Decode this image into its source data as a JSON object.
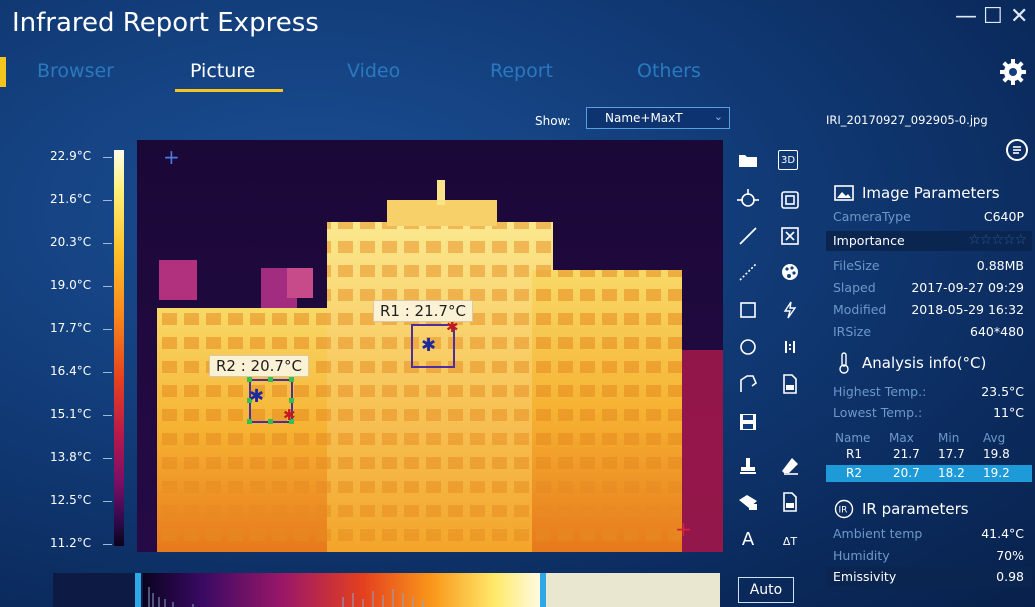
{
  "app": {
    "title": "Infrared Report Express"
  },
  "window": {
    "minimize": "—",
    "maximize": "☐",
    "close": "✕"
  },
  "tabs": [
    {
      "label": "Browser",
      "active": false
    },
    {
      "label": "Picture",
      "active": true
    },
    {
      "label": "Video",
      "active": false
    },
    {
      "label": "Report",
      "active": false
    },
    {
      "label": "Others",
      "active": false
    }
  ],
  "show": {
    "label": "Show:",
    "value": "Name+MaxT"
  },
  "file": {
    "name": "IRI_20170927_092905-0.jpg"
  },
  "scale": {
    "ticks": [
      "22.9°C",
      "21.6°C",
      "20.3°C",
      "19.0°C",
      "17.7°C",
      "16.4°C",
      "15.1°C",
      "13.8°C",
      "12.5°C",
      "11.2°C"
    ]
  },
  "rois": [
    {
      "label": "R1 : 21.7°C"
    },
    {
      "label": "R2 : 20.7°C"
    }
  ],
  "tools": {
    "btn_3d": "3D",
    "text_a": "A",
    "text_at": "ΔT"
  },
  "histogram": {
    "auto_label": "Auto"
  },
  "image_params": {
    "title": "Image Parameters",
    "camera_type_label": "CameraType",
    "camera_type": "C640P",
    "importance_label": "Importance",
    "importance_stars": "☆☆☆☆☆",
    "filesize_label": "FileSize",
    "filesize": "0.88MB",
    "slaped_label": "Slaped",
    "slaped": "2017-09-27 09:29",
    "modified_label": "Modified",
    "modified": "2018-05-29 16:32",
    "irsize_label": "IRSize",
    "irsize": "640*480"
  },
  "analysis": {
    "title": "Analysis info(°C)",
    "highest_label": "Highest Temp.:",
    "highest": "23.5°C",
    "lowest_label": "Lowest Temp.:",
    "lowest": "11°C",
    "headers": [
      "Name",
      "Max",
      "Min",
      "Avg"
    ],
    "rows": [
      {
        "name": "R1",
        "max": "21.7",
        "min": "17.7",
        "avg": "19.8"
      },
      {
        "name": "R2",
        "max": "20.7",
        "min": "18.2",
        "avg": "19.2"
      }
    ]
  },
  "ir_params": {
    "title": "IR parameters",
    "ambient_label": "Ambient temp",
    "ambient": "41.4°C",
    "humidity_label": "Humidity",
    "humidity": "70%",
    "emissivity_label": "Emissivity",
    "emissivity": "0.98"
  },
  "colors": {
    "accent": "#f4c51c",
    "tab_inactive": "#2a79bf",
    "highlight_row": "#1d9ad7"
  }
}
